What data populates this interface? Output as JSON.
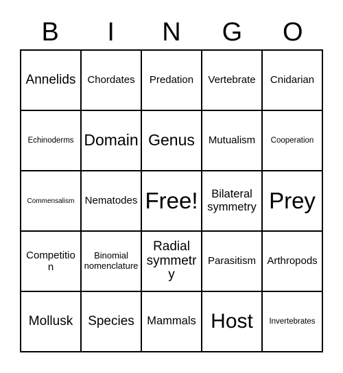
{
  "card": {
    "title_letters": [
      "B",
      "I",
      "N",
      "G",
      "O"
    ],
    "colors": {
      "border": "#000000",
      "cell_background": "#ffffff",
      "text": "#000000",
      "page_background": "#ffffff"
    },
    "grid": {
      "columns": 5,
      "rows": 5,
      "free_space_label": "Free!",
      "free_space_position": {
        "row": 3,
        "column": 3
      }
    },
    "rows": [
      [
        {
          "label": "Annelids",
          "size": "l"
        },
        {
          "label": "Chordates",
          "size": "m"
        },
        {
          "label": "Predation",
          "size": "m"
        },
        {
          "label": "Vertebrate",
          "size": "m"
        },
        {
          "label": "Cnidarian",
          "size": "m"
        }
      ],
      [
        {
          "label": "Echinoderms",
          "size": "xs"
        },
        {
          "label": "Domain",
          "size": "xl"
        },
        {
          "label": "Genus",
          "size": "xl"
        },
        {
          "label": "Mutualism",
          "size": "m"
        },
        {
          "label": "Cooperation",
          "size": "xs"
        }
      ],
      [
        {
          "label": "Commensalism",
          "size": "xxs"
        },
        {
          "label": "Nematodes",
          "size": "m"
        },
        {
          "label": "Free!",
          "size": "huge"
        },
        {
          "label": "Bilateral symmetry",
          "size": "ml"
        },
        {
          "label": "Prey",
          "size": "huge"
        }
      ],
      [
        {
          "label": "Competition",
          "size": "m"
        },
        {
          "label": "Binomial nomenclature",
          "size": "s"
        },
        {
          "label": "Radial symmetry",
          "size": "l"
        },
        {
          "label": "Parasitism",
          "size": "m"
        },
        {
          "label": "Arthropods",
          "size": "m"
        }
      ],
      [
        {
          "label": "Mollusk",
          "size": "l"
        },
        {
          "label": "Species",
          "size": "l"
        },
        {
          "label": "Mammals",
          "size": "ml"
        },
        {
          "label": "Host",
          "size": "xxl"
        },
        {
          "label": "Invertebrates",
          "size": "xs"
        }
      ]
    ]
  }
}
